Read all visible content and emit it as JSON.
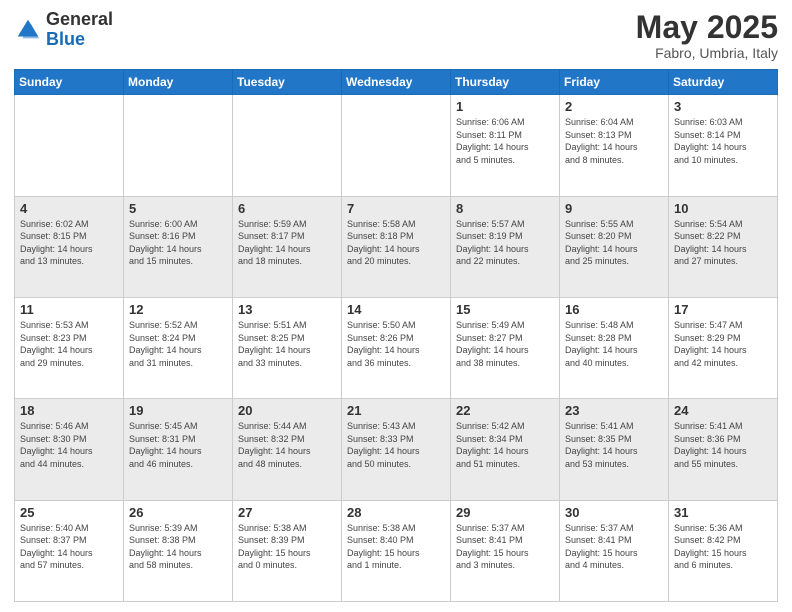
{
  "header": {
    "logo_general": "General",
    "logo_blue": "Blue",
    "month_title": "May 2025",
    "subtitle": "Fabro, Umbria, Italy"
  },
  "days_of_week": [
    "Sunday",
    "Monday",
    "Tuesday",
    "Wednesday",
    "Thursday",
    "Friday",
    "Saturday"
  ],
  "weeks": [
    [
      {
        "day": "",
        "info": ""
      },
      {
        "day": "",
        "info": ""
      },
      {
        "day": "",
        "info": ""
      },
      {
        "day": "",
        "info": ""
      },
      {
        "day": "1",
        "info": "Sunrise: 6:06 AM\nSunset: 8:11 PM\nDaylight: 14 hours\nand 5 minutes."
      },
      {
        "day": "2",
        "info": "Sunrise: 6:04 AM\nSunset: 8:13 PM\nDaylight: 14 hours\nand 8 minutes."
      },
      {
        "day": "3",
        "info": "Sunrise: 6:03 AM\nSunset: 8:14 PM\nDaylight: 14 hours\nand 10 minutes."
      }
    ],
    [
      {
        "day": "4",
        "info": "Sunrise: 6:02 AM\nSunset: 8:15 PM\nDaylight: 14 hours\nand 13 minutes."
      },
      {
        "day": "5",
        "info": "Sunrise: 6:00 AM\nSunset: 8:16 PM\nDaylight: 14 hours\nand 15 minutes."
      },
      {
        "day": "6",
        "info": "Sunrise: 5:59 AM\nSunset: 8:17 PM\nDaylight: 14 hours\nand 18 minutes."
      },
      {
        "day": "7",
        "info": "Sunrise: 5:58 AM\nSunset: 8:18 PM\nDaylight: 14 hours\nand 20 minutes."
      },
      {
        "day": "8",
        "info": "Sunrise: 5:57 AM\nSunset: 8:19 PM\nDaylight: 14 hours\nand 22 minutes."
      },
      {
        "day": "9",
        "info": "Sunrise: 5:55 AM\nSunset: 8:20 PM\nDaylight: 14 hours\nand 25 minutes."
      },
      {
        "day": "10",
        "info": "Sunrise: 5:54 AM\nSunset: 8:22 PM\nDaylight: 14 hours\nand 27 minutes."
      }
    ],
    [
      {
        "day": "11",
        "info": "Sunrise: 5:53 AM\nSunset: 8:23 PM\nDaylight: 14 hours\nand 29 minutes."
      },
      {
        "day": "12",
        "info": "Sunrise: 5:52 AM\nSunset: 8:24 PM\nDaylight: 14 hours\nand 31 minutes."
      },
      {
        "day": "13",
        "info": "Sunrise: 5:51 AM\nSunset: 8:25 PM\nDaylight: 14 hours\nand 33 minutes."
      },
      {
        "day": "14",
        "info": "Sunrise: 5:50 AM\nSunset: 8:26 PM\nDaylight: 14 hours\nand 36 minutes."
      },
      {
        "day": "15",
        "info": "Sunrise: 5:49 AM\nSunset: 8:27 PM\nDaylight: 14 hours\nand 38 minutes."
      },
      {
        "day": "16",
        "info": "Sunrise: 5:48 AM\nSunset: 8:28 PM\nDaylight: 14 hours\nand 40 minutes."
      },
      {
        "day": "17",
        "info": "Sunrise: 5:47 AM\nSunset: 8:29 PM\nDaylight: 14 hours\nand 42 minutes."
      }
    ],
    [
      {
        "day": "18",
        "info": "Sunrise: 5:46 AM\nSunset: 8:30 PM\nDaylight: 14 hours\nand 44 minutes."
      },
      {
        "day": "19",
        "info": "Sunrise: 5:45 AM\nSunset: 8:31 PM\nDaylight: 14 hours\nand 46 minutes."
      },
      {
        "day": "20",
        "info": "Sunrise: 5:44 AM\nSunset: 8:32 PM\nDaylight: 14 hours\nand 48 minutes."
      },
      {
        "day": "21",
        "info": "Sunrise: 5:43 AM\nSunset: 8:33 PM\nDaylight: 14 hours\nand 50 minutes."
      },
      {
        "day": "22",
        "info": "Sunrise: 5:42 AM\nSunset: 8:34 PM\nDaylight: 14 hours\nand 51 minutes."
      },
      {
        "day": "23",
        "info": "Sunrise: 5:41 AM\nSunset: 8:35 PM\nDaylight: 14 hours\nand 53 minutes."
      },
      {
        "day": "24",
        "info": "Sunrise: 5:41 AM\nSunset: 8:36 PM\nDaylight: 14 hours\nand 55 minutes."
      }
    ],
    [
      {
        "day": "25",
        "info": "Sunrise: 5:40 AM\nSunset: 8:37 PM\nDaylight: 14 hours\nand 57 minutes."
      },
      {
        "day": "26",
        "info": "Sunrise: 5:39 AM\nSunset: 8:38 PM\nDaylight: 14 hours\nand 58 minutes."
      },
      {
        "day": "27",
        "info": "Sunrise: 5:38 AM\nSunset: 8:39 PM\nDaylight: 15 hours\nand 0 minutes."
      },
      {
        "day": "28",
        "info": "Sunrise: 5:38 AM\nSunset: 8:40 PM\nDaylight: 15 hours\nand 1 minute."
      },
      {
        "day": "29",
        "info": "Sunrise: 5:37 AM\nSunset: 8:41 PM\nDaylight: 15 hours\nand 3 minutes."
      },
      {
        "day": "30",
        "info": "Sunrise: 5:37 AM\nSunset: 8:41 PM\nDaylight: 15 hours\nand 4 minutes."
      },
      {
        "day": "31",
        "info": "Sunrise: 5:36 AM\nSunset: 8:42 PM\nDaylight: 15 hours\nand 6 minutes."
      }
    ]
  ]
}
